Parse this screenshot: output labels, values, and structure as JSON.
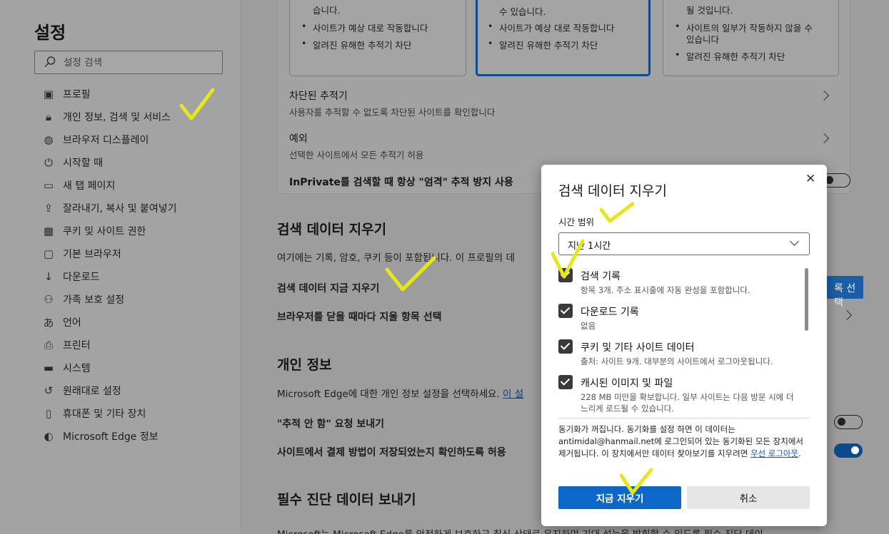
{
  "sidebar": {
    "title": "설정",
    "search_placeholder": "설정 검색",
    "items": [
      {
        "label": "프로필",
        "icon": "profile-icon"
      },
      {
        "label": "개인 정보, 검색 및 서비스",
        "icon": "lock-icon"
      },
      {
        "label": "브라우저 디스플레이",
        "icon": "palette-icon"
      },
      {
        "label": "시작할 때",
        "icon": "power-icon"
      },
      {
        "label": "새 탭 페이지",
        "icon": "new-tab-icon"
      },
      {
        "label": "잘라내기, 복사 및 붙여넣기",
        "icon": "share-icon"
      },
      {
        "label": "쿠키 및 사이트 권한",
        "icon": "cookie-site-icon"
      },
      {
        "label": "기본 브라우저",
        "icon": "browser-icon"
      },
      {
        "label": "다운로드",
        "icon": "download-icon"
      },
      {
        "label": "가족 보호 설정",
        "icon": "family-icon"
      },
      {
        "label": "언어",
        "icon": "language-icon"
      },
      {
        "label": "프린터",
        "icon": "printer-icon"
      },
      {
        "label": "시스템",
        "icon": "system-icon"
      },
      {
        "label": "원래대로 설정",
        "icon": "reset-icon"
      },
      {
        "label": "휴대폰 및 기타 장치",
        "icon": "phone-icon"
      },
      {
        "label": "Microsoft Edge 정보",
        "icon": "edge-icon"
      }
    ]
  },
  "tracking": {
    "options": [
      {
        "line1": "습니다.",
        "bullets": [
          "사이트가 예상 대로 작동합니다",
          "알려진 유해한 추적기 차단"
        ]
      },
      {
        "line1": "수 있습니다.",
        "bullets": [
          "사이트가 예상 대로 작동합니다",
          "알려진 유해한 추적기 차단"
        ]
      },
      {
        "line1": "될 것입니다.",
        "bullets": [
          "사이트의 일부가 작동하지 않을 수",
          "있습니다",
          "알려진 유해한 추적기 차단"
        ]
      }
    ],
    "blocked_title": "차단된 추적기",
    "blocked_sub": "사용자를 추적할 수 없도록 차단된 사이트를 확인합니다",
    "exceptions_title": "예외",
    "exceptions_sub": "선택한 사이트에서 모든 추적기 허용",
    "inprivate": "InPrivate를 검색할 때 항상 \"엄격\" 추적 방지 사용"
  },
  "clear_section": {
    "heading": "검색 데이터 지우기",
    "desc": "여기에는 기록, 암호, 쿠키 등이 포함됩니다. 이 프로필의 데",
    "clear_now": "검색 데이터 지금 지우기",
    "choose_button": "록 선택",
    "on_close": "브라우저를 닫을 때마다 지울 항목 선택"
  },
  "privacy_section": {
    "heading": "개인 정보",
    "desc": "Microsoft Edge에 대한 개인 정보 설정을 선택하세요.",
    "desc_link": "이 설",
    "dnt": "\"추적 안 함\" 요청 보내기",
    "payment": "사이트에서 결제 방법이 저장되었는지 확인하도록 허용"
  },
  "diag_section": {
    "heading": "필수 진단 데이터 보내기",
    "desc": "Microsoft는 Microsoft Edge를 안전하게 보호하고 최신 상태로 유지하며 기대 성능을 발휘할 수 있도록 필수 진단 데이"
  },
  "dialog": {
    "title": "검색 데이터 지우기",
    "close_glyph": "✕",
    "time_range_label": "시간 범위",
    "time_range_value": "지난 1시간",
    "items": [
      {
        "title": "검색 기록",
        "desc": "항목 3개. 주소 표시줄에 자동 완성을 포함합니다."
      },
      {
        "title": "다운로드 기록",
        "desc": "없음"
      },
      {
        "title": "쿠키 및 기타 사이트 데이터",
        "desc": "출처: 사이트 9개. 대부분의 사이트에서 로그아웃됩니다."
      },
      {
        "title": "캐시된 이미지 및 파일",
        "desc": "228 MB 미만을 확보합니다. 일부 사이트는 다음 방문 시에 더 느리게 로드될 수 있습니다."
      }
    ],
    "sync_text": "동기화가 꺼집니다. 동기화를 설정 하면 이 데이터는 antimidal@hanmail.net에 로그인되어 있는 동기화된 모든 장치에서 제거됩니다. 이 장치에서만 데이터 찾아보기를 지우려면 ",
    "sync_link": "우선 로그아웃",
    "sync_end": ".",
    "clear_button": "지금 지우기",
    "cancel_button": "취소"
  },
  "colors": {
    "primary": "#0d67c9",
    "annotation": "#e6e61c"
  }
}
